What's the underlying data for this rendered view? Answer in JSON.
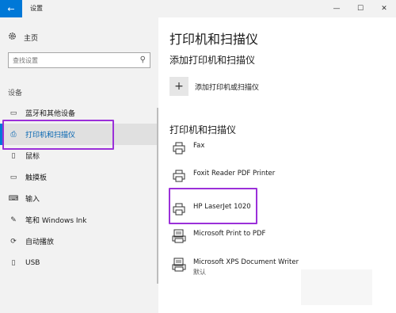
{
  "window": {
    "title": "设置",
    "back_icon": "back-arrow-icon",
    "min": "—",
    "max": "☐",
    "close": "✕"
  },
  "sidebar": {
    "home_label": "主页",
    "search_placeholder": "查找设置",
    "section_label": "设备",
    "items": [
      {
        "label": "蓝牙和其他设备",
        "icon": "bluetooth-devices-icon",
        "glyph": "▭"
      },
      {
        "label": "打印机和扫描仪",
        "icon": "printer-icon",
        "glyph": "⎙",
        "active": true
      },
      {
        "label": "鼠标",
        "icon": "mouse-icon",
        "glyph": "▯"
      },
      {
        "label": "触摸板",
        "icon": "touchpad-icon",
        "glyph": "▭"
      },
      {
        "label": "输入",
        "icon": "keyboard-icon",
        "glyph": "⌨"
      },
      {
        "label": "笔和 Windows Ink",
        "icon": "pen-icon",
        "glyph": "✎"
      },
      {
        "label": "自动播放",
        "icon": "autoplay-icon",
        "glyph": "⟳"
      },
      {
        "label": "USB",
        "icon": "usb-icon",
        "glyph": "▯"
      }
    ]
  },
  "main": {
    "title": "打印机和扫描仪",
    "add_heading": "添加打印机和扫描仪",
    "add_button_label": "添加打印机或扫描仪",
    "add_icon": "+",
    "list_heading": "打印机和扫描仪",
    "printers": [
      {
        "name": "Fax",
        "status": ""
      },
      {
        "name": "Foxit Reader PDF Printer",
        "status": ""
      },
      {
        "name": "HP LaserJet 1020",
        "status": ""
      },
      {
        "name": "Microsoft Print to PDF",
        "status": ""
      },
      {
        "name": "Microsoft XPS Document Writer",
        "status": "默认"
      }
    ]
  },
  "colors": {
    "accent": "#0078d7",
    "highlight": "#9b30d9",
    "sidebar_bg": "#f2f2f2"
  }
}
